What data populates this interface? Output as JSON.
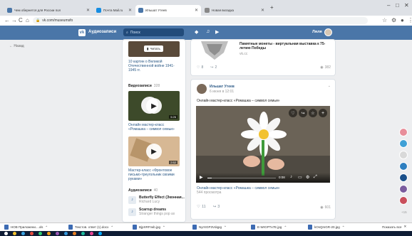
{
  "browser": {
    "tabs": [
      {
        "title": "Чем обернется для России пол",
        "color": "#4a76a8",
        "active": false
      },
      {
        "title": "Почта Mail.ru",
        "color": "#168de2",
        "active": false
      },
      {
        "title": "Ильшат Утеев",
        "color": "#4a76a8",
        "active": true
      },
      {
        "title": "Новая вкладка",
        "color": "#888888",
        "active": false
      }
    ],
    "new_tab": "+",
    "window_controls": [
      "–",
      "□",
      "✕"
    ],
    "url": "vk.com/museumsfo",
    "nav": [
      "←",
      "→",
      "C",
      "⌂"
    ]
  },
  "vk": {
    "logo_letter": "vk",
    "site_name": "Аудиозаписи",
    "search_placeholder": "Поиск",
    "user_name": "Ляля",
    "left_nav": "← Назад"
  },
  "sidebar": {
    "top_card_button": "Читать",
    "top_card_text": "10 картин о Великой Отечественной войне 1941-1945 гг.",
    "videos_header": "Видеозаписи",
    "videos_count": "328",
    "video1_duration": "5:26",
    "video1_title": "Онлайн мастер-класс «Ромашка – символ семьи»",
    "video2_duration": "2:52",
    "video2_title": "Мастер-класс «Фронтовое письмо-треугольник своими руками»",
    "audio_header": "Аудиозаписи",
    "audio_count": "40",
    "audio": [
      {
        "title": "Butterfly Effect (Эконная...",
        "artist": "Richard Lucy"
      },
      {
        "title": "Scarrup dreams",
        "artist": "Stranger things pop ax"
      }
    ]
  },
  "post1": {
    "title": "Памятные монеты - виртуальная выставка к 75-летию Победы",
    "source": "vk.cc",
    "likes": "8",
    "reposts": "2",
    "views": "382"
  },
  "post2": {
    "author": "Ильшат Утеев",
    "date": "6 июня в 12:01",
    "text": "Онлайн мастер-класс «Ромашка – символ семьи»",
    "video_time": "0:08",
    "caption": "Онлайн мастер-класс «Ромашка – символ семьи»",
    "caption_views": "544 просмотра",
    "likes": "11",
    "reposts": "3",
    "views": "601"
  },
  "downloads": [
    {
      "name": "НОВ Приложени....xls"
    },
    {
      "name": "Текстов. ответ (1).docx"
    },
    {
      "name": "BjpXRFrwb.jpg"
    },
    {
      "name": "NyrXGP3Vdqpg"
    },
    {
      "name": "E-WrGPTx7E.jpg"
    },
    {
      "name": "kOsQmGR-20.jpg"
    }
  ],
  "show_all": "Показать все",
  "side_avatar_colors": [
    "#e88e9a",
    "#3fa0d6",
    "#d9d9d9",
    "#2e7fc0",
    "#1a4f8a",
    "#7a5c9e",
    "#c94f5c"
  ],
  "side_label": "+15",
  "taskbar_colors": [
    "#ffffff",
    "#f2c230",
    "#3aa3e3",
    "#e74c3c",
    "#2ecc71",
    "#f39c12",
    "#9b59b6",
    "#3498db",
    "#e67e22",
    "#1abc9c",
    "#e84393",
    "#00a8ff"
  ],
  "colors": {
    "vk_blue": "#4a76a8",
    "link": "#2a5885"
  }
}
